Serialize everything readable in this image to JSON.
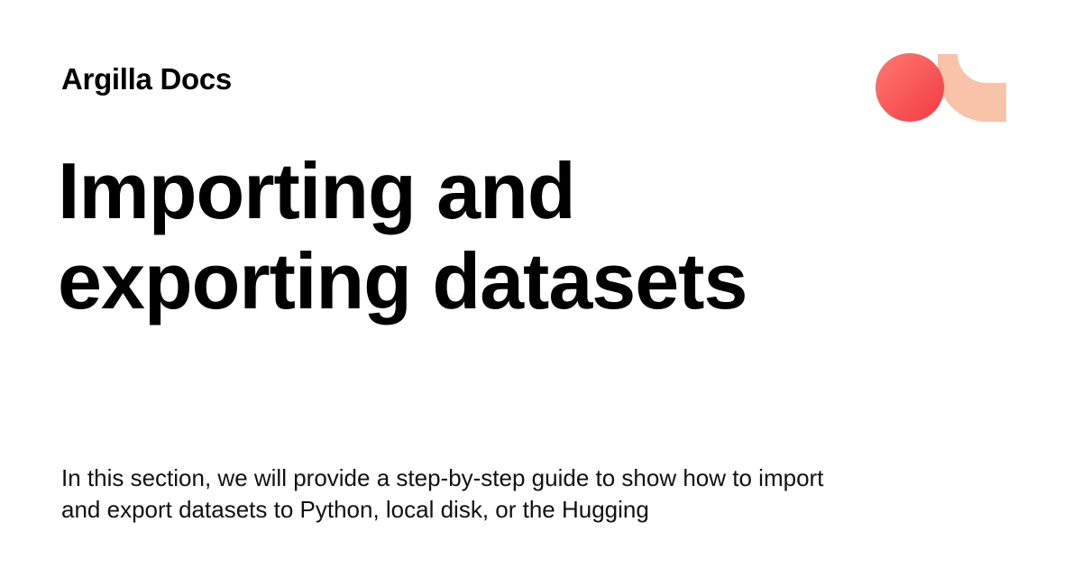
{
  "header": {
    "site_name": "Argilla Docs"
  },
  "main": {
    "title": "Importing and exporting datasets",
    "description": "In this section, we will provide a step-by-step guide to show how to import and export datasets to Python, local disk, or the Hugging"
  },
  "logo": {
    "icon": "argilla-logo-icon",
    "colors": {
      "circle_light": "#ff7a70",
      "circle_dark": "#f33a43",
      "arc": "#f9c3a9"
    }
  },
  "colors": {
    "background": "#ffffff",
    "text": "#000000"
  }
}
